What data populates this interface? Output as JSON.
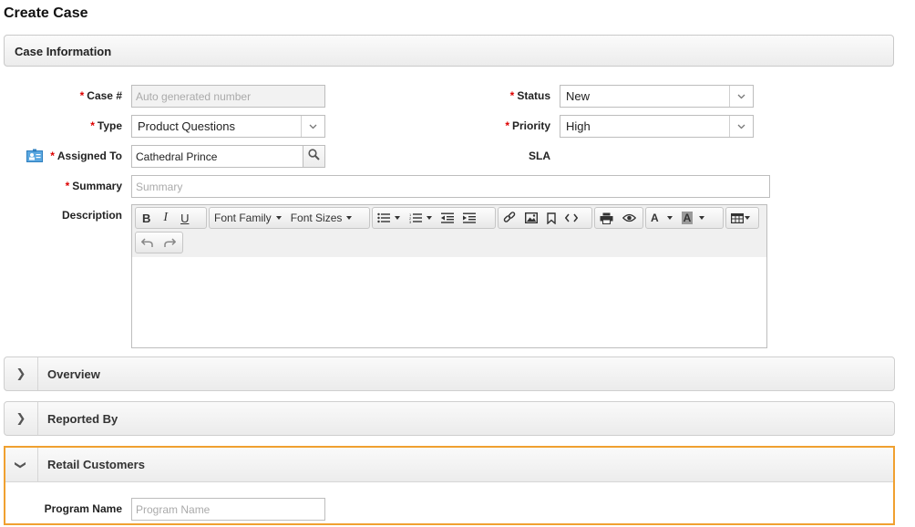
{
  "page": {
    "title": "Create Case"
  },
  "case_information": {
    "title": "Case Information",
    "case_number": {
      "label": "Case #",
      "placeholder": "Auto generated number",
      "value": ""
    },
    "status": {
      "label": "Status",
      "value": "New"
    },
    "type": {
      "label": "Type",
      "value": "Product Questions"
    },
    "priority": {
      "label": "Priority",
      "value": "High"
    },
    "assigned_to": {
      "label": "Assigned To",
      "value": "Cathedral Prince"
    },
    "sla": {
      "label": "SLA"
    },
    "summary": {
      "label": "Summary",
      "placeholder": "Summary",
      "value": ""
    },
    "description": {
      "label": "Description"
    }
  },
  "editor": {
    "font_family": "Font Family",
    "font_sizes": "Font Sizes",
    "buttons": [
      "bold",
      "italic",
      "underline",
      "bullet-list",
      "numbered-list",
      "outdent",
      "indent",
      "link",
      "image",
      "bookmark",
      "source-code",
      "print",
      "preview",
      "text-color",
      "background-color",
      "table",
      "undo",
      "redo"
    ]
  },
  "sections": {
    "overview": {
      "title": "Overview",
      "toggle": "❯"
    },
    "reported_by": {
      "title": "Reported By",
      "toggle": "❯"
    },
    "retail_customers": {
      "title": "Retail Customers",
      "toggle": "❯"
    }
  },
  "retail_customers": {
    "program_name": {
      "label": "Program Name",
      "placeholder": "Program Name",
      "value": ""
    }
  },
  "colors": {
    "required": "#dd0000",
    "highlight_border": "#f0a030"
  }
}
